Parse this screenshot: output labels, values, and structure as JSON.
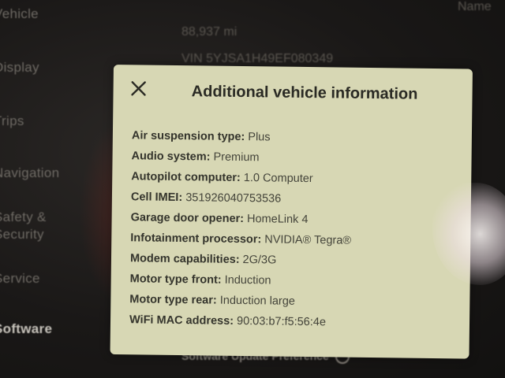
{
  "background": {
    "menu_items": [
      {
        "label": "Vehicle"
      },
      {
        "label": "Display"
      },
      {
        "label": "Trips"
      },
      {
        "label": "Navigation"
      },
      {
        "label": "Safety &"
      },
      {
        "label": "Security"
      },
      {
        "label": "Service"
      },
      {
        "label": "Software"
      }
    ],
    "odometer": "88,937 mi",
    "vin": "VIN 5YJSA1H49EF080349",
    "top_right_text": "Name",
    "software_update_preference": "Software Update Preference"
  },
  "modal": {
    "title": "Additional vehicle information",
    "items": [
      {
        "label": "Air suspension type:",
        "value": "Plus"
      },
      {
        "label": "Audio system:",
        "value": "Premium"
      },
      {
        "label": "Autopilot computer:",
        "value": "1.0 Computer"
      },
      {
        "label": "Cell IMEI:",
        "value": "351926040753536"
      },
      {
        "label": "Garage door opener:",
        "value": "HomeLink 4"
      },
      {
        "label": "Infotainment processor:",
        "value": "NVIDIA® Tegra®"
      },
      {
        "label": "Modem capabilities:",
        "value": "2G/3G"
      },
      {
        "label": "Motor type front:",
        "value": "Induction"
      },
      {
        "label": "Motor type rear:",
        "value": "Induction large"
      },
      {
        "label": "WiFi MAC address:",
        "value": "90:03:b7:f5:56:4e"
      }
    ]
  },
  "icons": {
    "close": "close-icon",
    "info": "info-icon"
  }
}
